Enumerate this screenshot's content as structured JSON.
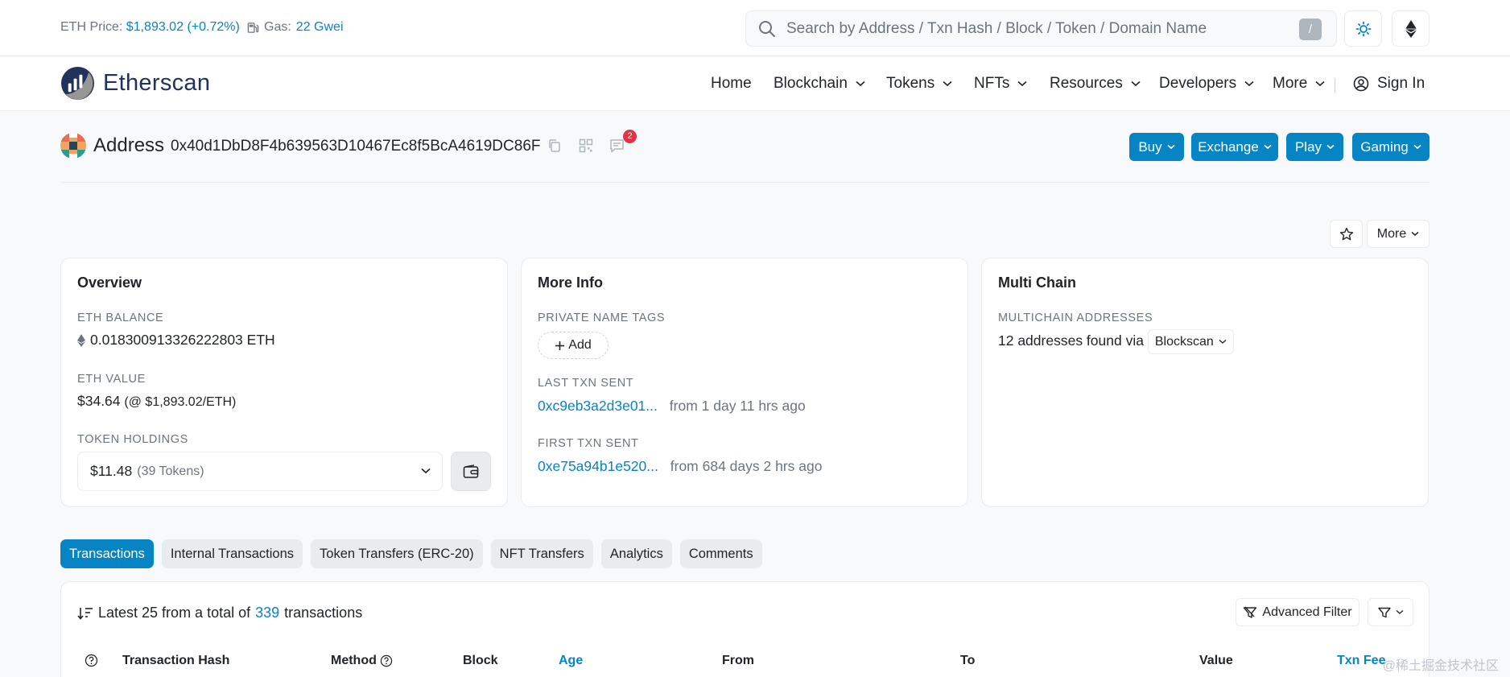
{
  "topbar": {
    "price_label": "ETH Price:",
    "price_value": "$1,893.02",
    "price_change": "(+0.72%)",
    "gas_label": "Gas:",
    "gas_value": "22 Gwei",
    "search_placeholder": "Search by Address / Txn Hash / Block / Token / Domain Name",
    "search_shortcut": "/"
  },
  "nav": {
    "logo_text": "Etherscan",
    "items": [
      "Home",
      "Blockchain",
      "Tokens",
      "NFTs",
      "Resources",
      "Developers",
      "More"
    ],
    "sign_in": "Sign In"
  },
  "address": {
    "title": "Address",
    "hash": "0x40d1DbD8F4b639563D10467Ec8f5BcA4619DC86F",
    "comment_count": "2",
    "actions": [
      "Buy",
      "Exchange",
      "Play",
      "Gaming"
    ],
    "more_label": "More"
  },
  "overview": {
    "heading": "Overview",
    "eth_balance_label": "ETH BALANCE",
    "eth_balance_value": "0.018300913326222803 ETH",
    "eth_value_label": "ETH VALUE",
    "eth_value_amount": "$34.64",
    "eth_value_rate": "(@ $1,893.02/ETH)",
    "token_holdings_label": "TOKEN HOLDINGS",
    "token_holdings_value": "$11.48",
    "token_holdings_count": "(39 Tokens)"
  },
  "more_info": {
    "heading": "More Info",
    "private_tags_label": "PRIVATE NAME TAGS",
    "add_label": "Add",
    "last_txn_label": "LAST TXN SENT",
    "last_txn_hash": "0xc9eb3a2d3e01...",
    "last_txn_age": "from 1 day 11 hrs ago",
    "first_txn_label": "FIRST TXN SENT",
    "first_txn_hash": "0xe75a94b1e520...",
    "first_txn_age": "from 684 days 2 hrs ago"
  },
  "multi_chain": {
    "heading": "Multi Chain",
    "addresses_label": "MULTICHAIN ADDRESSES",
    "addresses_text": "12 addresses found via",
    "source_select": "Blockscan"
  },
  "tabs": [
    "Transactions",
    "Internal Transactions",
    "Token Transfers (ERC-20)",
    "NFT Transfers",
    "Analytics",
    "Comments"
  ],
  "transactions": {
    "summary_prefix": "Latest 25 from a total of",
    "summary_count": "339",
    "summary_suffix": "transactions",
    "advanced_filter": "Advanced Filter",
    "columns": [
      "Transaction Hash",
      "Method",
      "Block",
      "Age",
      "From",
      "To",
      "Value",
      "Txn Fee"
    ]
  },
  "watermark": "@稀土掘金技术社区",
  "colors": {
    "accent": "#0784c3",
    "text": "#212529",
    "muted": "#6c757d",
    "danger": "#dc3545"
  }
}
